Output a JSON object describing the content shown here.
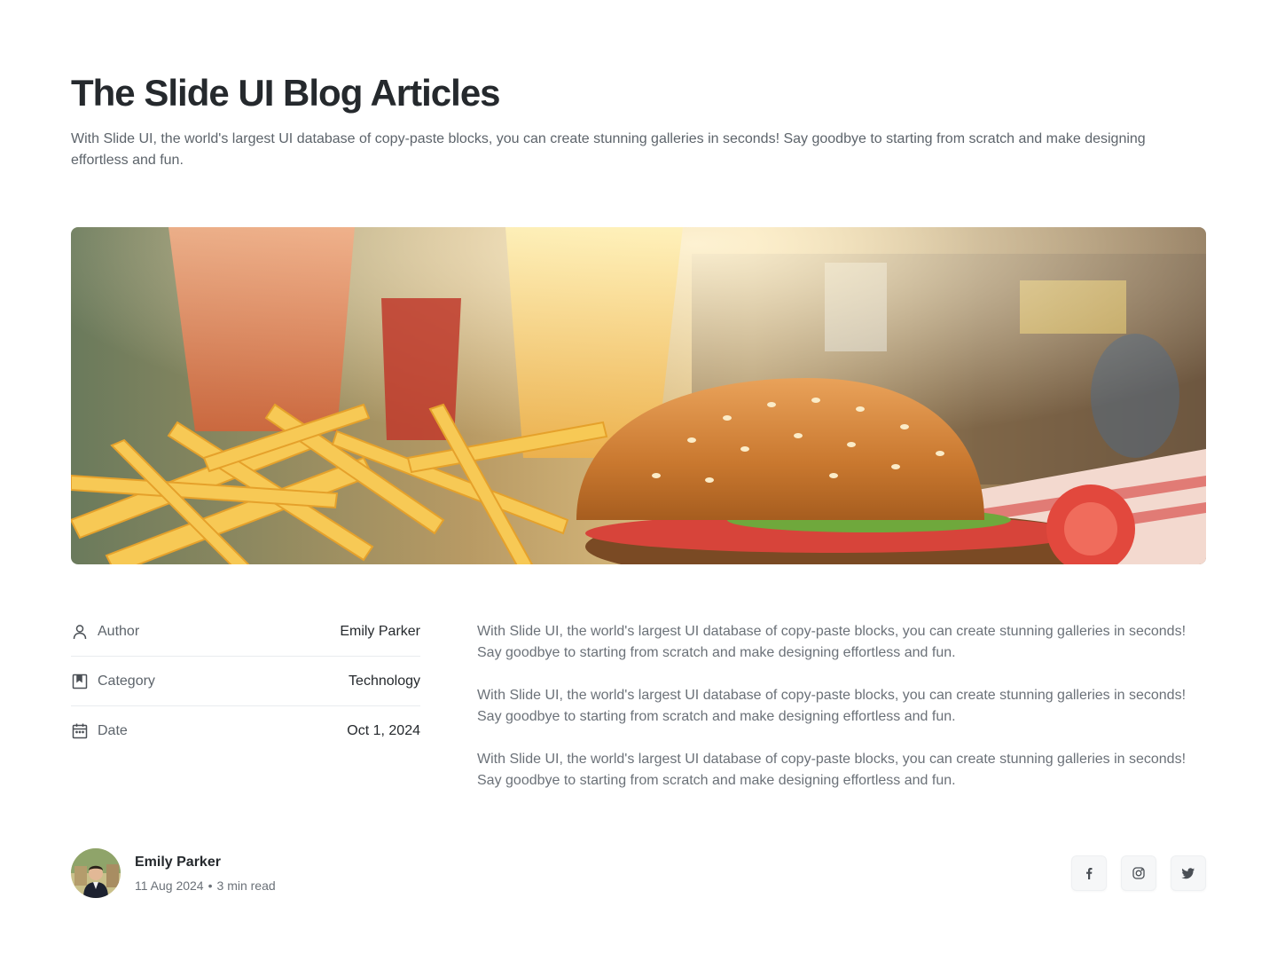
{
  "header": {
    "title": "The Slide UI Blog Articles",
    "description": "With Slide UI, the world's largest UI database of copy-paste blocks, you can create stunning galleries in seconds! Say goodbye to starting from scratch and make designing effortless and fun."
  },
  "meta": {
    "author_label": "Author",
    "author_value": "Emily Parker",
    "category_label": "Category",
    "category_value": "Technology",
    "date_label": "Date",
    "date_value": "Oct 1, 2024"
  },
  "body": {
    "paragraphs": [
      "With Slide UI, the world's largest UI database of copy-paste blocks, you can create stunning galleries in seconds! Say goodbye to starting from scratch and make designing effortless and fun.",
      "With Slide UI, the world's largest UI database of copy-paste blocks, you can create stunning galleries in seconds! Say goodbye to starting from scratch and make designing effortless and fun.",
      "With Slide UI, the world's largest UI database of copy-paste blocks, you can create stunning galleries in seconds! Say goodbye to starting from scratch and make designing effortless and fun."
    ]
  },
  "author_card": {
    "name": "Emily Parker",
    "date": "11 Aug 2024",
    "separator": "•",
    "read_time": "3 min read"
  },
  "socials": {
    "icons": [
      "facebook-icon",
      "instagram-icon",
      "twitter-icon"
    ]
  },
  "colors": {
    "text_primary": "#25292d",
    "text_muted": "#6b7178",
    "divider": "#e9ecef",
    "icon": "#4a4f55"
  }
}
